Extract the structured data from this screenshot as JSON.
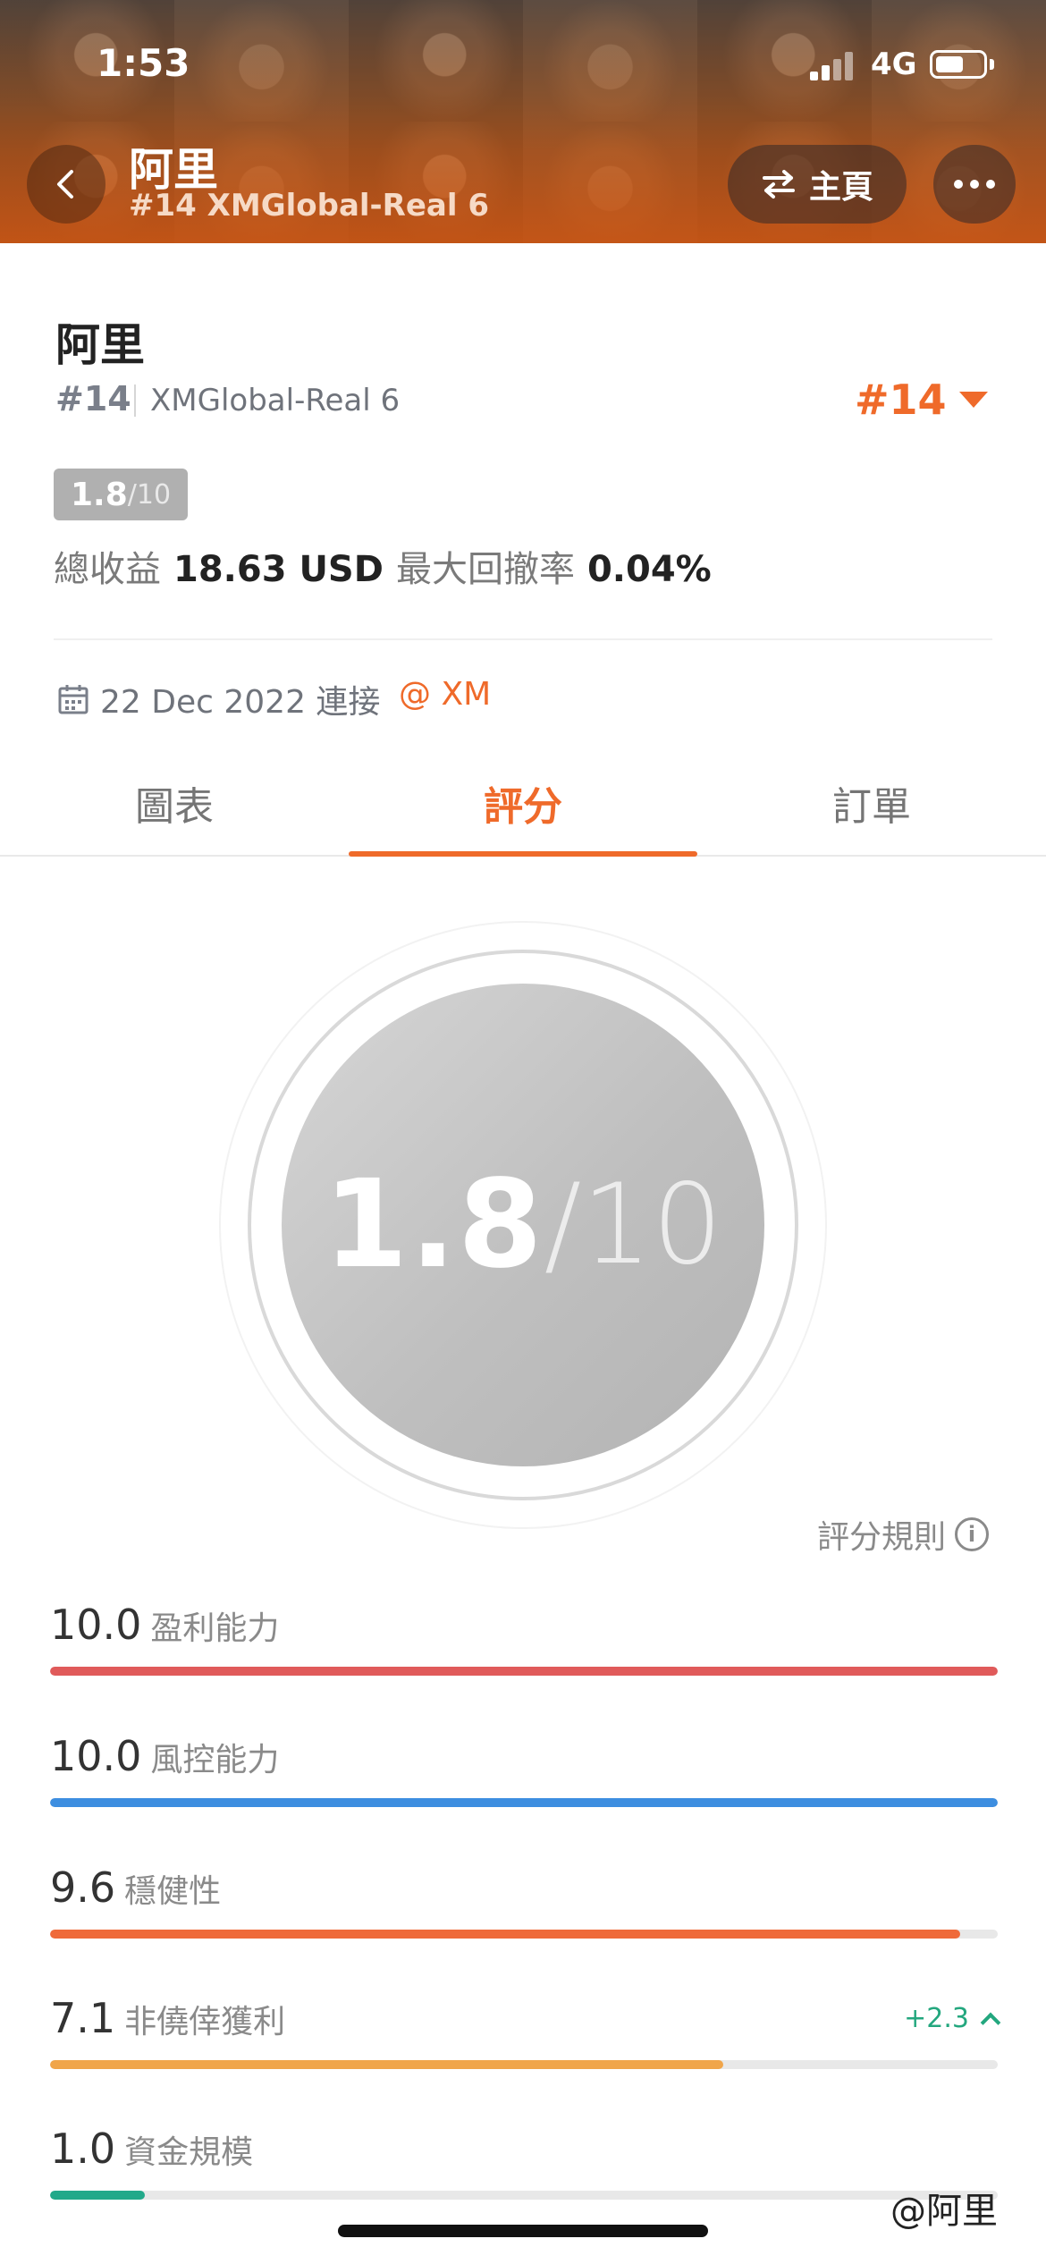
{
  "status_bar": {
    "time": "1:53",
    "network": "4G"
  },
  "header": {
    "name": "阿里",
    "subtitle": "#14 XMGlobal-Real 6",
    "home_label": "主頁"
  },
  "profile": {
    "name": "阿里",
    "rank": "#14",
    "server": "XMGlobal-Real 6",
    "rank_badge": "#14",
    "score": "1.8",
    "score_denominator": "/10",
    "total_profit_label": "總收益",
    "total_profit_value": "18.63 USD",
    "max_drawdown_label": "最大回撤率",
    "max_drawdown_value": "0.04%",
    "connect_date": "22 Dec 2022 連接",
    "broker": "@ XM"
  },
  "tabs": [
    {
      "label": "圖表"
    },
    {
      "label": "評分"
    },
    {
      "label": "訂單"
    }
  ],
  "score_circle": {
    "score": "1.8",
    "denominator": "/10"
  },
  "rules_label": "評分規則",
  "metrics": [
    {
      "value": "10.0",
      "label": "盈利能力",
      "fill": 1.0,
      "color": "#e05a5a"
    },
    {
      "value": "10.0",
      "label": "風控能力",
      "fill": 1.0,
      "color": "#3d8ee0"
    },
    {
      "value": "9.6",
      "label": "穩健性",
      "fill": 0.96,
      "color": "#ef6a3a"
    },
    {
      "value": "7.1",
      "label": "非僥倖獲利",
      "fill": 0.71,
      "color": "#f0a54a",
      "delta": "+2.3"
    },
    {
      "value": "1.0",
      "label": "資金規模",
      "fill": 0.1,
      "color": "#22a98a"
    }
  ],
  "watermark": "@阿里",
  "colors": {
    "accent": "#ef6a2a",
    "header": "#c55215"
  }
}
